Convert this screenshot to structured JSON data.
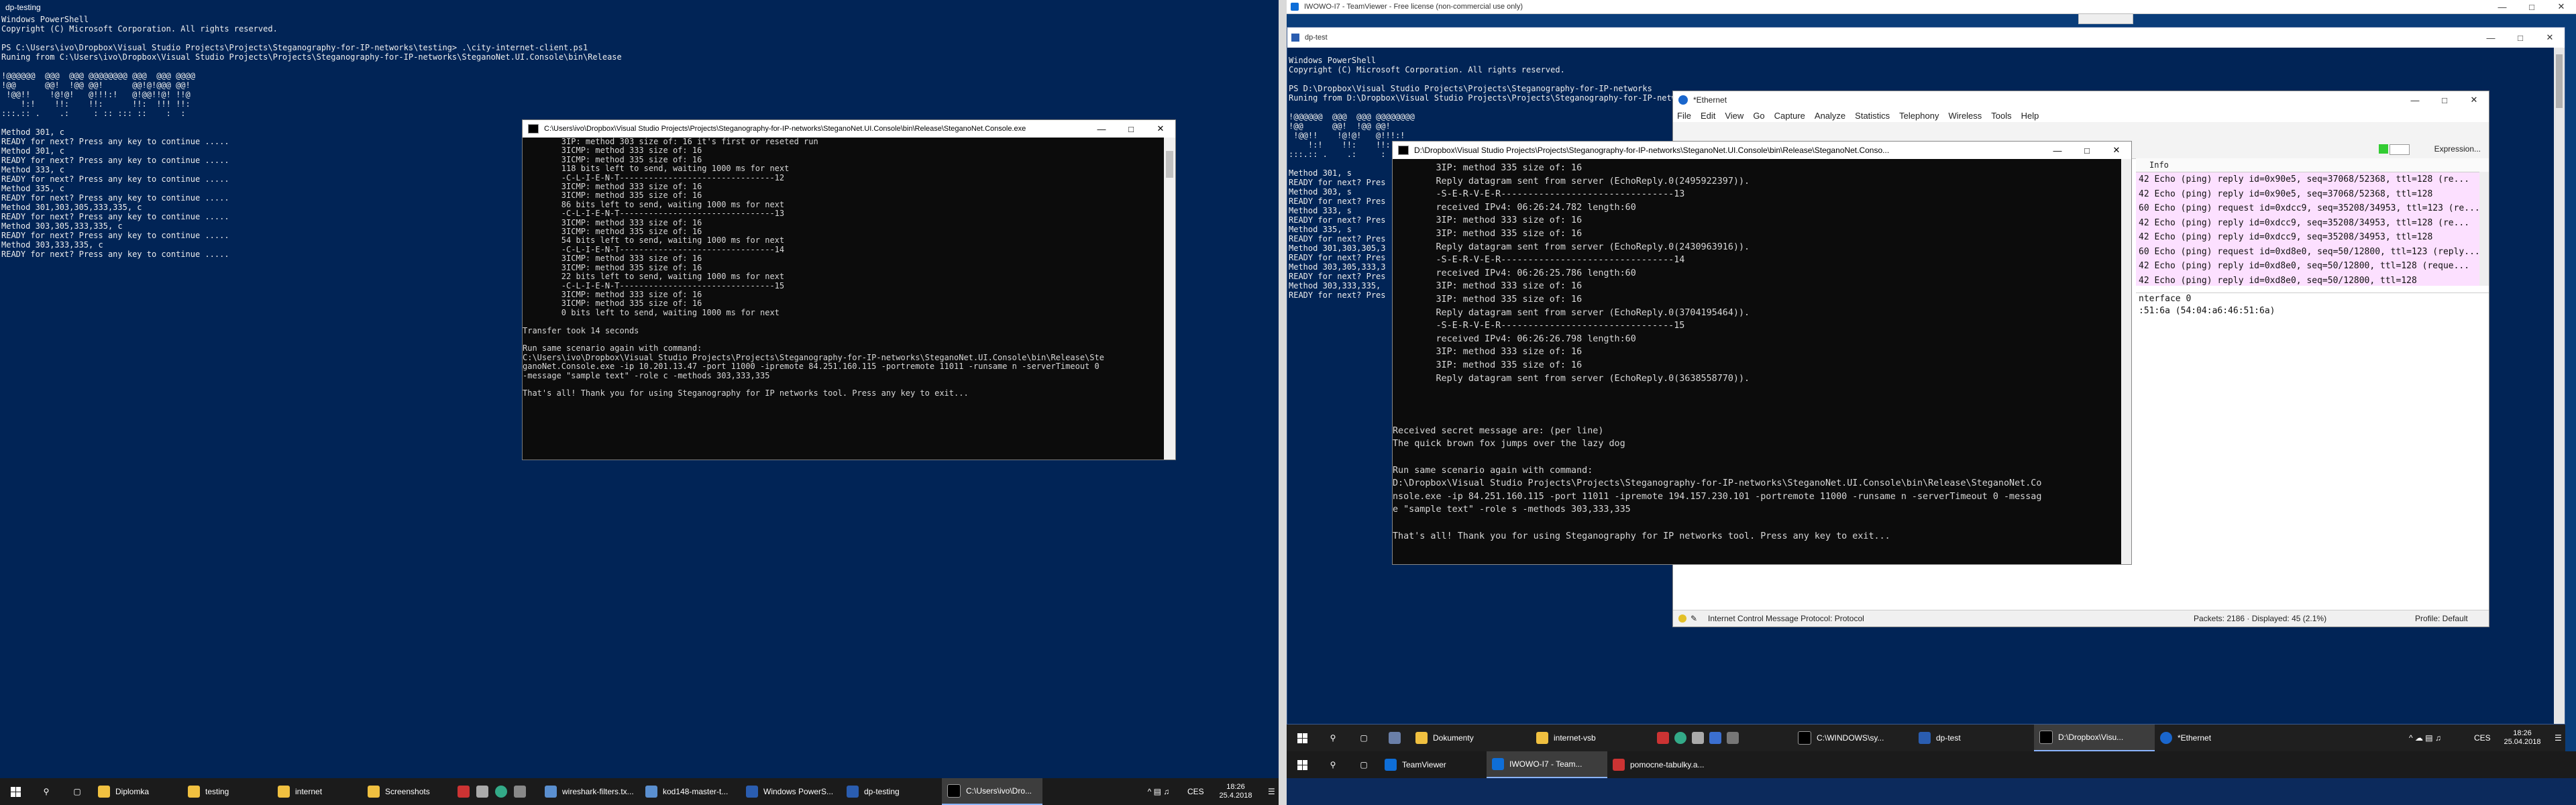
{
  "left_ps": {
    "title": "dp-testing",
    "lines": [
      "Windows PowerShell",
      "Copyright (C) Microsoft Corporation. All rights reserved.",
      "",
      "PS C:\\Users\\ivo\\Dropbox\\Visual Studio Projects\\Projects\\Steganography-for-IP-networks\\testing> .\\city-internet-client.ps1",
      "Runing from C:\\Users\\ivo\\Dropbox\\Visual Studio Projects\\Projects\\Steganography-for-IP-networks\\SteganoNet.UI.Console\\bin\\Release",
      "",
      "!@@@@@@  @@@  @@@ @@@@@@@@ @@@  @@@ @@@@",
      "!@@      @@!  !@@ @@!      @@!@!@@@ @@!",
      " !@@!!    !@!@!   @!!!:!   @!@@!!@! !!@",
      "    !:!    !!:    !!:      !!:  !!! !!:",
      ":::.:: .    .:     : :: ::: ::    :  :",
      "",
      "Method 301, c",
      "READY for next? Press any key to continue .....",
      "Method 301, c",
      "READY for next? Press any key to continue .....",
      "Method 333, c",
      "READY for next? Press any key to continue .....",
      "Method 335, c",
      "READY for next? Press any key to continue .....",
      "Method 301,303,305,333,335, c",
      "READY for next? Press any key to continue .....",
      "Method 303,305,333,335, c",
      "READY for next? Press any key to continue .....",
      "Method 303,333,335, c",
      "READY for next? Press any key to continue ....."
    ]
  },
  "left_console": {
    "title": "C:\\Users\\ivo\\Dropbox\\Visual Studio Projects\\Projects\\Steganography-for-IP-networks\\SteganoNet.UI.Console\\bin\\Release\\SteganoNet.Console.exe",
    "lines": [
      "        3IP: method 303 size of: 16 it's first or reseted run",
      "        3ICMP: method 333 size of: 16",
      "        3ICMP: method 335 size of: 16",
      "        118 bits left to send, waiting 1000 ms for next",
      "        -C-L-I-E-N-T--------------------------------12",
      "        3ICMP: method 333 size of: 16",
      "        3ICMP: method 335 size of: 16",
      "        86 bits left to send, waiting 1000 ms for next",
      "        -C-L-I-E-N-T--------------------------------13",
      "        3ICMP: method 333 size of: 16",
      "        3ICMP: method 335 size of: 16",
      "        54 bits left to send, waiting 1000 ms for next",
      "        -C-L-I-E-N-T--------------------------------14",
      "        3ICMP: method 333 size of: 16",
      "        3ICMP: method 335 size of: 16",
      "        22 bits left to send, waiting 1000 ms for next",
      "        -C-L-I-E-N-T--------------------------------15",
      "        3ICMP: method 333 size of: 16",
      "        3ICMP: method 335 size of: 16",
      "        0 bits left to send, waiting 1000 ms for next",
      "",
      "Transfer took 14 seconds",
      "",
      "Run same scenario again with command:",
      "C:\\Users\\ivo\\Dropbox\\Visual Studio Projects\\Projects\\Steganography-for-IP-networks\\SteganoNet.UI.Console\\bin\\Release\\Ste",
      "ganoNet.Console.exe -ip 10.201.13.47 -port 11000 -ipremote 84.251.160.115 -portremote 11011 -runsame n -serverTimeout 0",
      "-message \"sample text\" -role c -methods 303,333,335",
      "",
      "That's all! Thank you for using Steganography for IP networks tool. Press any key to exit..."
    ]
  },
  "left_taskbar": {
    "clock": "18:26",
    "date": "25.4.2018",
    "lang": "CES",
    "items": [
      "Diplomka",
      "testing",
      "internet",
      "Screenshots",
      "wireshark-filters.tx...",
      "kod148-master-t...",
      "Windows PowerS...",
      "dp-testing",
      "C:\\Users\\ivo\\Dro..."
    ]
  },
  "teamviewer": {
    "title": "IWOWO-I7 - TeamViewer - Free license (non-commercial use only)"
  },
  "right_ps": {
    "title": "dp-test",
    "lines": [
      "Windows PowerShell",
      "Copyright (C) Microsoft Corporation. All rights reserved.",
      "",
      "PS D:\\Dropbox\\Visual Studio Projects\\Projects\\Steganography-for-IP-networks",
      "Runing from D:\\Dropbox\\Visual Studio Projects\\Projects\\Steganography-for-IP-networks",
      "",
      "!@@@@@@  @@@  @@@ @@@@@@@@",
      "!@@      @@!  !@@ @@!",
      " !@@!!    !@!@!   @!!!:!",
      "    !:!    !!:    !!:",
      ":::.:: .    .:     : :: :::",
      "",
      "Method 301, s",
      "READY for next? Pres",
      "Method 303, s",
      "READY for next? Pres",
      "Method 333, s",
      "READY for next? Pres",
      "Method 335, s",
      "READY for next? Pres",
      "Method 301,303,305,3",
      "READY for next? Pres",
      "Method 303,305,333,3",
      "READY for next? Pres",
      "Method 303,333,335,",
      "READY for next? Pres"
    ]
  },
  "right_console": {
    "title": "D:\\Dropbox\\Visual Studio Projects\\Projects\\Steganography-for-IP-networks\\SteganoNet.UI.Console\\bin\\Release\\SteganoNet.Conso...",
    "lines": [
      "        3IP: method 335 size of: 16",
      "        Reply datagram sent from server (EchoReply.0(2495922397)).",
      "        -S-E-R-V-E-R--------------------------------13",
      "        received IPv4: 06:26:24.782 length:60",
      "        3IP: method 333 size of: 16",
      "        3IP: method 335 size of: 16",
      "        Reply datagram sent from server (EchoReply.0(2430963916)).",
      "        -S-E-R-V-E-R--------------------------------14",
      "        received IPv4: 06:26:25.786 length:60",
      "        3IP: method 333 size of: 16",
      "        3IP: method 335 size of: 16",
      "        Reply datagram sent from server (EchoReply.0(3704195464)).",
      "        -S-E-R-V-E-R--------------------------------15",
      "        received IPv4: 06:26:26.798 length:60",
      "        3IP: method 333 size of: 16",
      "        3IP: method 335 size of: 16",
      "        Reply datagram sent from server (EchoReply.0(3638558770)).",
      "",
      "",
      "",
      "Received secret message are: (per line)",
      "The quick brown fox jumps over the lazy dog",
      "",
      "Run same scenario again with command:",
      "D:\\Dropbox\\Visual Studio Projects\\Projects\\Steganography-for-IP-networks\\SteganoNet.UI.Console\\bin\\Release\\SteganoNet.Co",
      "nsole.exe -ip 84.251.160.115 -port 11011 -ipremote 194.157.230.101 -portremote 11000 -runsame n -serverTimeout 0 -messag",
      "e \"sample text\" -role s -methods 303,333,335",
      "",
      "That's all! Thank you for using Steganography for IP networks tool. Press any key to exit..."
    ]
  },
  "wireshark": {
    "title": "*Ethernet",
    "menu": [
      "File",
      "Edit",
      "View",
      "Go",
      "Capture",
      "Analyze",
      "Statistics",
      "Telephony",
      "Wireless",
      "Tools",
      "Help"
    ],
    "expression_label": "Expression...",
    "info_header": "Info",
    "rows": [
      "42 Echo (ping) reply     id=0x90e5, seq=37068/52368, ttl=128 (re...",
      "42 Echo (ping) reply     id=0x90e5, seq=37068/52368, ttl=128",
      "60 Echo (ping) request   id=0xdcc9, seq=35208/34953, ttl=123 (re...",
      "42 Echo (ping) reply     id=0xdcc9, seq=35208/34953, ttl=128 (re...",
      "42 Echo (ping) reply     id=0xdcc9, seq=35208/34953, ttl=128",
      "60 Echo (ping) request   id=0xd8e0, seq=50/12800, ttl=123 (reply...",
      "42 Echo (ping) reply     id=0xd8e0, seq=50/12800, ttl=128 (reque...",
      "42 Echo (ping) reply     id=0xd8e0, seq=50/12800, ttl=128"
    ],
    "detail_lines": [
      "nterface 0",
      ":51:6a (54:04:a6:46:51:6a)"
    ],
    "status_protocol": "Internet Control Message Protocol: Protocol",
    "status_packets": "Packets: 2186 · Displayed: 45 (2.1%)",
    "status_profile": "Profile: Default"
  },
  "right_taskbar": {
    "clock": "18:26",
    "date": "25.04.2018",
    "lang": "CES",
    "items": [
      "Dokumenty",
      "internet-vsb",
      "C:\\WINDOWS\\sy...",
      "dp-test",
      "D:\\Dropbox\\Visu...",
      "*Ethernet"
    ]
  },
  "host_taskbar": {
    "items": [
      "TeamViewer",
      "IWOWO-I7 - Team...",
      "pomocne-tabulky.a..."
    ]
  }
}
